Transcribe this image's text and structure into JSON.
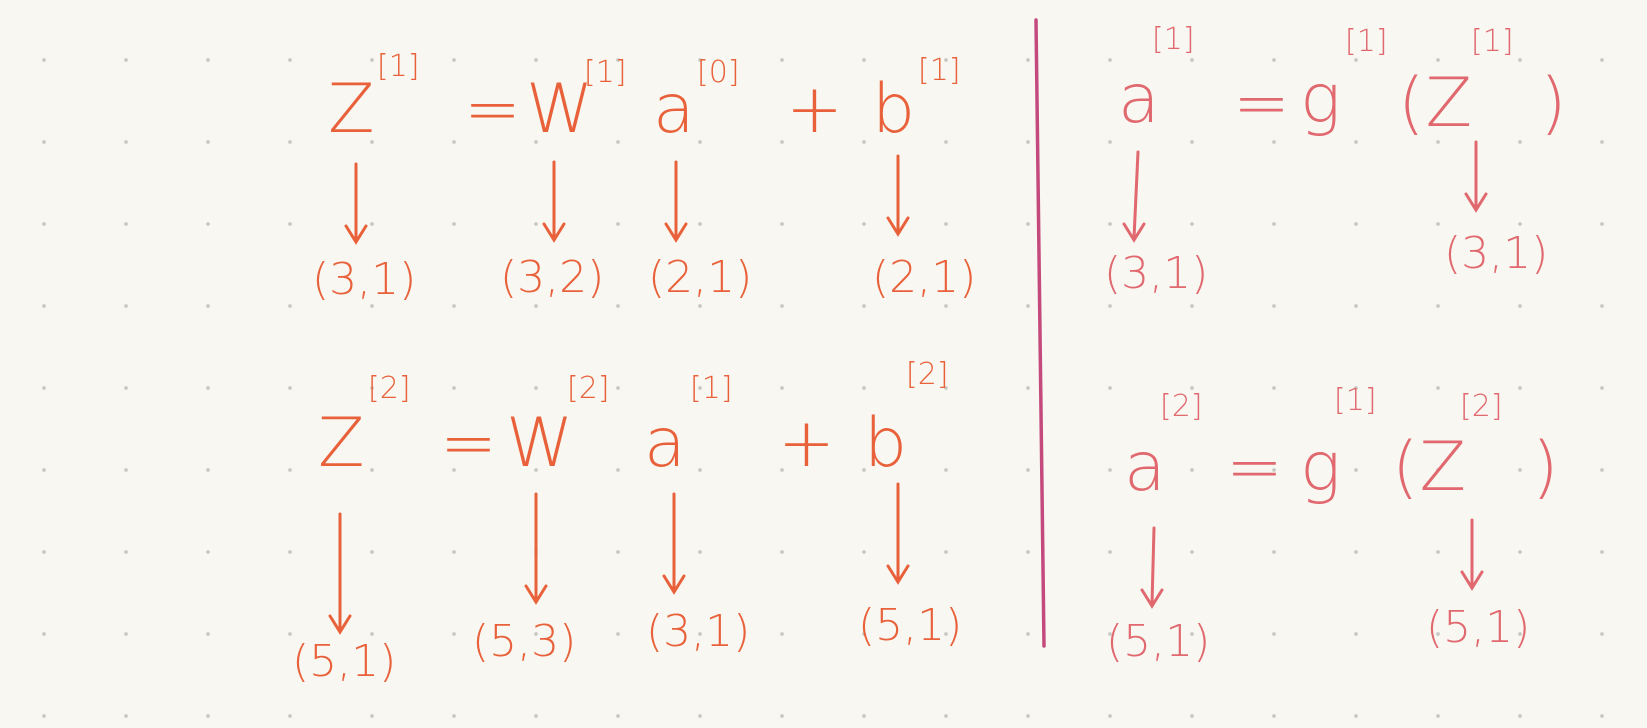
{
  "colors": {
    "background": "#f8f7f1",
    "dot_grid": "#c9c9c4",
    "ink_orange": "#e8613a",
    "ink_pink": "#e0686e",
    "divider": "#c44a7e"
  },
  "layer1": {
    "forward_eq": {
      "z": "Z",
      "z_sup": "[1]",
      "equals": "=",
      "w": "W",
      "w_sup": "[1]",
      "a": "a",
      "a_sup": "[0]",
      "plus": "+",
      "b": "b",
      "b_sup": "[1]",
      "z_dim": "(3,1)",
      "w_dim": "(3,2)",
      "a_dim": "(2,1)",
      "b_dim": "(2,1)"
    },
    "activation_eq": {
      "a": "a",
      "a_sup": "[1]",
      "equals": "=",
      "g": "g",
      "g_sup": "[1]",
      "z": "(Z",
      "z_sup": "[1]",
      "close": ")",
      "a_dim": "(3,1)",
      "z_dim": "(3,1)"
    }
  },
  "layer2": {
    "forward_eq": {
      "z": "Z",
      "z_sup": "[2]",
      "equals": "=",
      "w": "W",
      "w_sup": "[2]",
      "a": "a",
      "a_sup": "[1]",
      "plus": "+",
      "b": "b",
      "b_sup": "[2]",
      "z_dim": "(5,1)",
      "w_dim": "(5,3)",
      "a_dim": "(3,1)",
      "b_dim": "(5,1)"
    },
    "activation_eq": {
      "a": "a",
      "a_sup": "[2]",
      "equals": "=",
      "g": "g",
      "g_sup": "[1]",
      "z": "(Z",
      "z_sup": "[2]",
      "close": ")",
      "a_dim": "(5,1)",
      "z_dim": "(5,1)"
    }
  }
}
